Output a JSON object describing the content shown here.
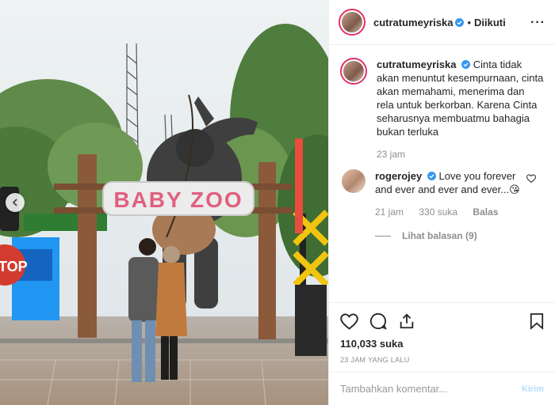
{
  "post": {
    "username": "cutratumeyriska",
    "follow_status": "Diikuti",
    "more_icon": "more-horizontal-icon"
  },
  "caption": {
    "username": "cutratumeyriska",
    "text": "Cinta tidak akan menuntut kesempurnaan, cinta akan memahami, menerima dan rela untuk berkorban. Karena Cinta seharusnya membuatmu bahagia bukan terluka",
    "time": "23 jam"
  },
  "comment": {
    "username": "rogerojey",
    "text": "Love you forever and ever and ever and ever...😘",
    "time": "21 jam",
    "likes": "330 suka",
    "reply_label": "Balas",
    "view_replies": "Lihat balasan (9)"
  },
  "photo": {
    "sign_text": "BABY ZOO",
    "stop_text": "TOP"
  },
  "actions": {
    "like_count": "110,033 suka",
    "time_ago": "23 JAM YANG LALU"
  },
  "add_comment": {
    "placeholder": "Tambahkan komentar...",
    "post_label": "Kirim"
  },
  "colors": {
    "verified": "#3897f0",
    "story_ring": "#e1306c",
    "post_button_disabled": "#b2dffc",
    "sign_text": "#e0607e"
  }
}
